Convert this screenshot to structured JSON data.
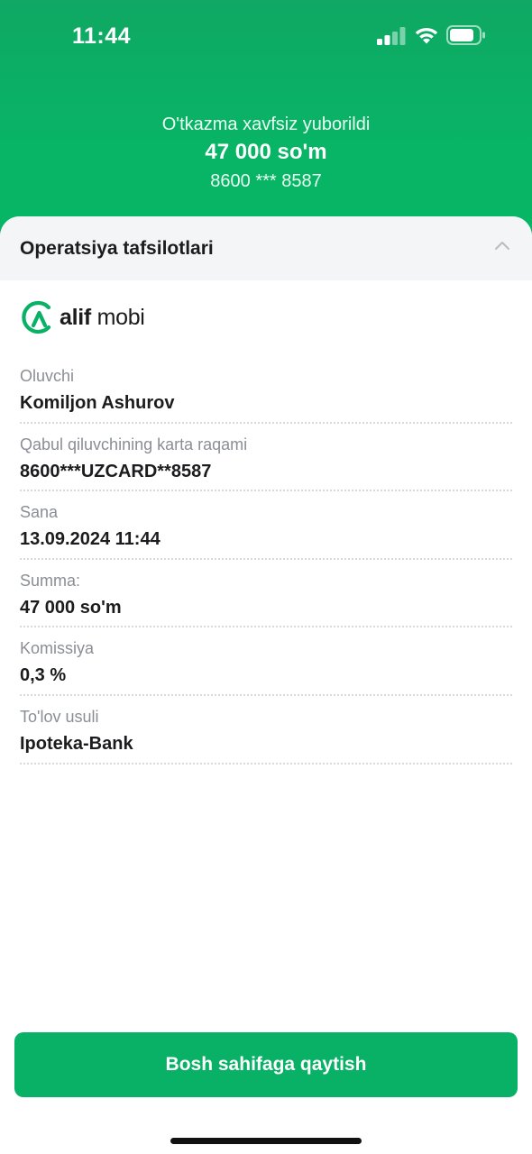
{
  "status_bar": {
    "time": "11:44"
  },
  "header": {
    "subtitle": "O'tkazma xavfsiz yuborildi",
    "amount": "47 000 so'm",
    "card_masked": "8600 *** 8587"
  },
  "section": {
    "title": "Operatsiya tafsilotlari"
  },
  "logo": {
    "brand_bold": "alif",
    "brand_regular": " mobi"
  },
  "details": [
    {
      "label": "Oluvchi",
      "value": "Komiljon Ashurov"
    },
    {
      "label": "Qabul qiluvchining karta raqami",
      "value": "8600***UZCARD**8587"
    },
    {
      "label": "Sana",
      "value": "13.09.2024 11:44"
    },
    {
      "label": "Summa:",
      "value": "47 000 so'm"
    },
    {
      "label": "Komissiya",
      "value": "0,3 %"
    },
    {
      "label": "To'lov usuli",
      "value": "Ipoteka-Bank"
    }
  ],
  "button": {
    "label": "Bosh sahifaga qaytish"
  },
  "colors": {
    "brand_green": "#08b166",
    "header_green": "#0fa864",
    "label_gray": "#8a8e95"
  }
}
